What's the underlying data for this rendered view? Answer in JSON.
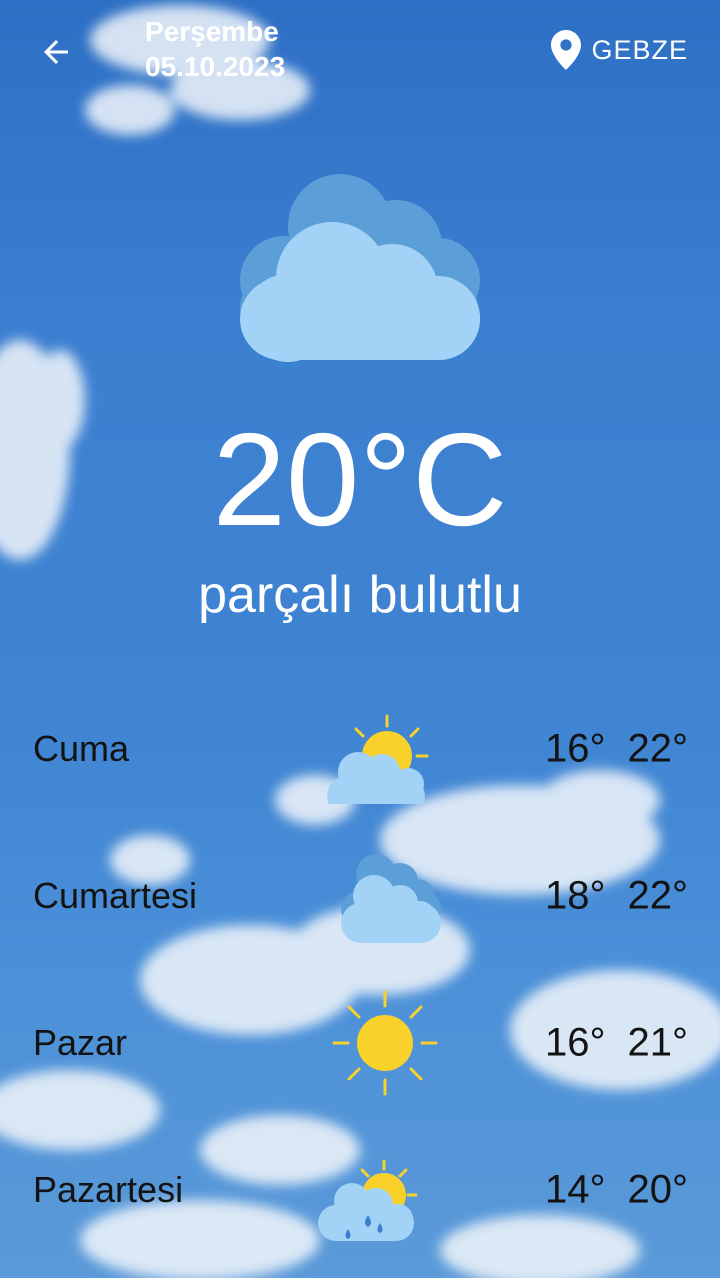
{
  "header": {
    "day_name": "Perşembe",
    "date": "05.10.2023",
    "location": "GEBZE",
    "back_icon": "arrow-back-icon",
    "location_icon": "map-pin-icon"
  },
  "current": {
    "temperature": "20°C",
    "description": "parçalı bulutlu",
    "icon": "cloudy-icon"
  },
  "forecast": [
    {
      "day": "Cuma",
      "min": "16°",
      "max": "22°",
      "icon": "partly-cloudy-icon"
    },
    {
      "day": "Cumartesi",
      "min": "18°",
      "max": "22°",
      "icon": "cloudy-icon"
    },
    {
      "day": "Pazar",
      "min": "16°",
      "max": "21°",
      "icon": "sunny-icon"
    },
    {
      "day": "Pazartesi",
      "min": "14°",
      "max": "20°",
      "icon": "rain-sun-icon"
    }
  ],
  "colors": {
    "sky": "#3c7fd0",
    "cloud_light": "#a3d2f7",
    "cloud_dark": "#5c9fd8",
    "sun": "#f8d12a",
    "text_dark": "#131313",
    "text_light": "#ffffff"
  }
}
